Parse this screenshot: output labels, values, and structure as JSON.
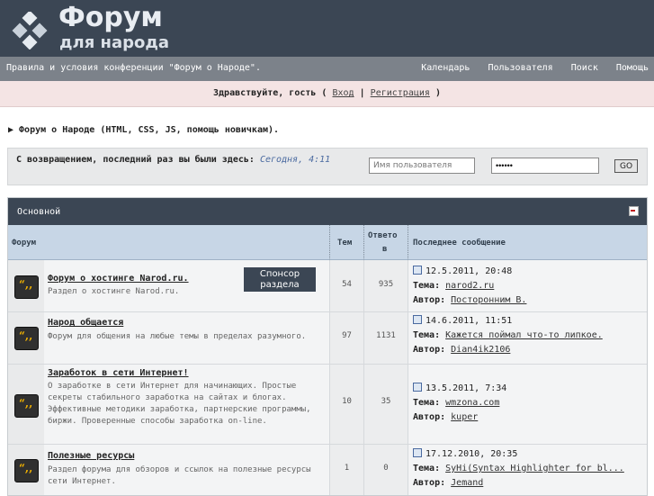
{
  "header": {
    "title": "Форум",
    "subtitle": "для народа"
  },
  "nav": {
    "left_text": "Правила и условия конференции \"Форум о Народе\".",
    "links": [
      "Календарь",
      "Пользователя",
      "Поиск",
      "Помощь"
    ]
  },
  "greeting": {
    "prefix": "Здравствуйте, гость (",
    "login": "Вход",
    "separator": "|",
    "register": "Регистрация",
    "suffix": ")"
  },
  "breadcrumb": "▶ Форум о Народе (HTML, CSS, JS, помощь новичкам).",
  "login": {
    "welcome_text": "С возвращением, последний раз вы были здесь:",
    "last_visit": "Сегодня, 4:11",
    "username_placeholder": "Имя пользователя",
    "password_value": "••••••",
    "go_label": "GO"
  },
  "category": {
    "title": "Основной"
  },
  "columns": {
    "forum": "Форум",
    "topics": "Тем",
    "replies_line1": "Ответо",
    "replies_line2": "в",
    "last_post": "Последнее сообщение"
  },
  "labels": {
    "topic": "Тема:",
    "author": "Автор:",
    "sponsor_line1": "Спонсор",
    "sponsor_line2": "раздела"
  },
  "forums": [
    {
      "name": "Форум о хостинге Narod.ru.",
      "description": "Раздел о хостинге Narod.ru.",
      "topics": "54",
      "replies": "935",
      "last_date": "12.5.2011, 20:48",
      "last_topic": "narod2.ru",
      "last_author": "Посторонним В."
    },
    {
      "name": "Народ общается",
      "description": "Форум для общения на любые темы в пределах разумного.",
      "topics": "97",
      "replies": "1131",
      "last_date": "14.6.2011, 11:51",
      "last_topic": "Кажется поймал что-то липкое.",
      "last_author": "Dian4ik2106"
    },
    {
      "name": "Заработок в сети Интернет!",
      "description": "О заработке в сети Интернет для начинающих. Простые секреты стабильного заработка на сайтах и блогах. Эффективные методики заработка, партнерские программы, биржи. Проверенные способы заработка on-line.",
      "topics": "10",
      "replies": "35",
      "last_date": "13.5.2011, 7:34",
      "last_topic": "wmzona.com",
      "last_author": "kuper"
    },
    {
      "name": "Полезные ресурсы",
      "description": "Раздел форума для обзоров и ссылок на полезные ресурсы сети Интернет.",
      "topics": "1",
      "replies": "0",
      "last_date": "17.12.2010, 20:35",
      "last_topic": "SyHi(Syntax Highlighter for bl...",
      "last_author": "Jemand"
    }
  ]
}
